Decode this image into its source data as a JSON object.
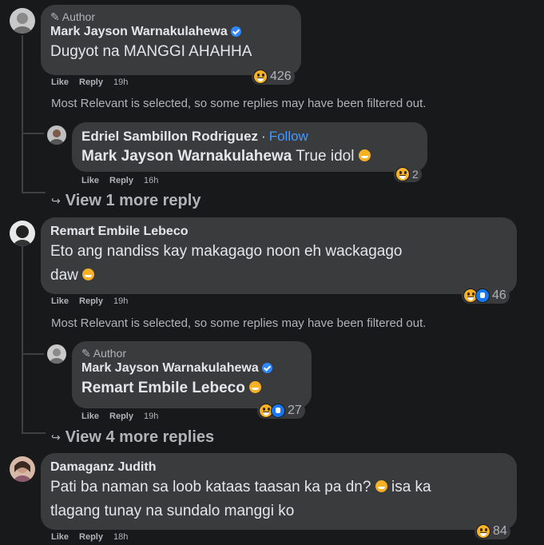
{
  "comments": [
    {
      "author_tag": "Author",
      "name": "Mark Jayson Warnakulahewa",
      "text": "Dugyot na MANGGI AHAHHA",
      "like": "Like",
      "reply": "Reply",
      "time": "19h",
      "reactions": "426",
      "notice": "Most Relevant is selected, so some replies may have been filtered out.",
      "reply_item": {
        "name": "Edriel Sambillon Rodriguez",
        "separator": "·",
        "follow": "Follow",
        "mention": "Mark Jayson Warnakulahewa",
        "text": "True idol",
        "like": "Like",
        "reply": "Reply",
        "time": "16h",
        "reactions": "2"
      },
      "view_more": "View 1 more reply"
    },
    {
      "name": "Remart Embile Lebeco",
      "text_line1": "Eto ang nandiss kay makagago noon eh wackagago",
      "text_line2": "daw",
      "like": "Like",
      "reply": "Reply",
      "time": "19h",
      "reactions": "46",
      "notice": "Most Relevant is selected, so some replies may have been filtered out.",
      "reply_item": {
        "author_tag": "Author",
        "name": "Mark Jayson Warnakulahewa",
        "mention": "Remart Embile Lebeco",
        "like": "Like",
        "reply": "Reply",
        "time": "19h",
        "reactions": "27"
      },
      "view_more": "View 4 more replies"
    },
    {
      "name": "Damaganz Judith",
      "text_line1": "Pati ba naman sa loob kataas taasan ka pa dn?",
      "text_line1b": "isa ka",
      "text_line2": "tlagang tunay na sundalo manggi ko",
      "like": "Like",
      "reply": "Reply",
      "time": "18h",
      "reactions": "84"
    }
  ],
  "colors": {
    "background": "#18191a",
    "bubble": "#3a3b3c",
    "verified": "#2d88ff",
    "follow": "#4599ff",
    "muted": "#b0b3b8"
  }
}
